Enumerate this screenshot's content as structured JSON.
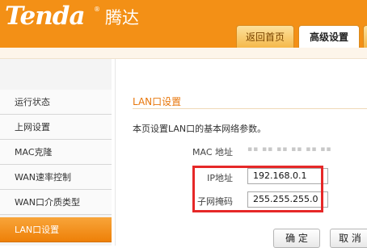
{
  "header": {
    "brand": "Tenda",
    "brand_mark": "®",
    "brand_cn": "腾达",
    "tabs": [
      {
        "label": "返回首页"
      },
      {
        "label": "高级设置"
      }
    ]
  },
  "sidebar": {
    "items": [
      {
        "label": "运行状态"
      },
      {
        "label": "上网设置"
      },
      {
        "label": "MAC克隆"
      },
      {
        "label": "WAN速率控制"
      },
      {
        "label": "WAN口介质类型"
      },
      {
        "label": "LAN口设置"
      }
    ],
    "active_index": 5
  },
  "content": {
    "section_title": "LAN口设置",
    "description": "本页设置LAN口的基本网络参数。",
    "mac_label": "MAC 地址",
    "mac_value": "▪▪ ▪▪ ▪▪ ▪▪ ▪▪ ▪▪",
    "ip_label": "IP地址",
    "ip_value": "192.168.0.1",
    "mask_label": "子网掩码",
    "mask_value": "255.255.255.0",
    "confirm_button": "确 定",
    "cancel_button": "取 消"
  },
  "colors": {
    "brand_orange": "#f39016",
    "highlight_red": "#e62828"
  }
}
